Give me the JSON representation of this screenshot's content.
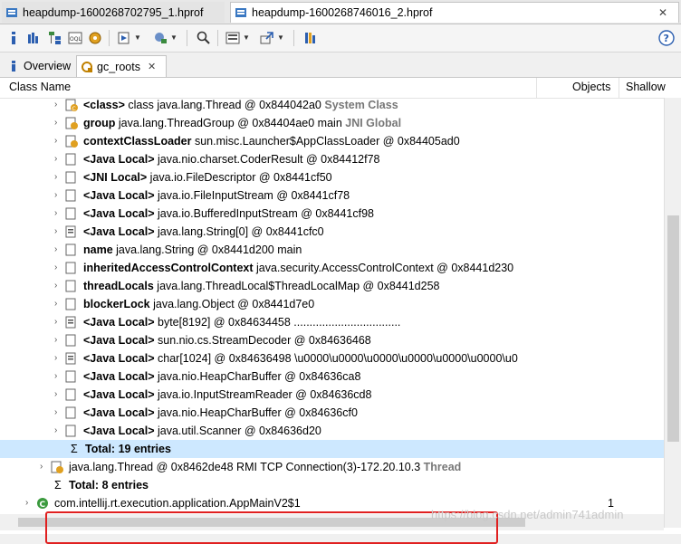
{
  "editor_tabs": [
    {
      "label": "heapdump-1600268702795_1.hprof"
    },
    {
      "label": "heapdump-1600268746016_2.hprof"
    }
  ],
  "view_tabs": [
    {
      "label": "Overview"
    },
    {
      "label": "gc_roots"
    }
  ],
  "columns": [
    "Class Name",
    "Objects",
    "Shallow"
  ],
  "rows": [
    {
      "bold": "<class>",
      "rest": " class java.lang.Thread @ 0x844042a0",
      "gray": " System Class"
    },
    {
      "bold": "group",
      "rest": " java.lang.ThreadGroup @ 0x84404ae0  main",
      "gray": " JNI Global"
    },
    {
      "bold": "contextClassLoader",
      "rest": " sun.misc.Launcher$AppClassLoader @ 0x84405ad0",
      "gray": ""
    },
    {
      "bold": "<Java Local>",
      "rest": " java.nio.charset.CoderResult @ 0x84412f78",
      "gray": ""
    },
    {
      "bold": "<JNI Local>",
      "rest": " java.io.FileDescriptor @ 0x8441cf50",
      "gray": ""
    },
    {
      "bold": "<Java Local>",
      "rest": " java.io.FileInputStream @ 0x8441cf78",
      "gray": ""
    },
    {
      "bold": "<Java Local>",
      "rest": " java.io.BufferedInputStream @ 0x8441cf98",
      "gray": ""
    },
    {
      "bold": "<Java Local>",
      "rest": " java.lang.String[0] @ 0x8441cfc0",
      "gray": ""
    },
    {
      "bold": "name",
      "rest": " java.lang.String @ 0x8441d200  main",
      "gray": ""
    },
    {
      "bold": "inheritedAccessControlContext",
      "rest": " java.security.AccessControlContext @ 0x8441d230",
      "gray": ""
    },
    {
      "bold": "threadLocals",
      "rest": " java.lang.ThreadLocal$ThreadLocalMap @ 0x8441d258",
      "gray": ""
    },
    {
      "bold": "blockerLock",
      "rest": " java.lang.Object @ 0x8441d7e0",
      "gray": ""
    },
    {
      "bold": "<Java Local>",
      "rest": " byte[8192] @ 0x84634458  ..................................",
      "gray": ""
    },
    {
      "bold": "<Java Local>",
      "rest": " sun.nio.cs.StreamDecoder @ 0x84636468",
      "gray": ""
    },
    {
      "bold": "<Java Local>",
      "rest": " char[1024] @ 0x84636498  \\u0000\\u0000\\u0000\\u0000\\u0000\\u0000\\u0",
      "gray": ""
    },
    {
      "bold": "<Java Local>",
      "rest": " java.nio.HeapCharBuffer @ 0x84636ca8",
      "gray": ""
    },
    {
      "bold": "<Java Local>",
      "rest": " java.io.InputStreamReader @ 0x84636cd8",
      "gray": ""
    },
    {
      "bold": "<Java Local>",
      "rest": " java.nio.HeapCharBuffer @ 0x84636cf0",
      "gray": ""
    },
    {
      "bold": "<Java Local>",
      "rest": " java.util.Scanner @ 0x84636d20",
      "gray": ""
    }
  ],
  "total_inner": "Total: 19 entries",
  "thread_row": {
    "rest": "java.lang.Thread @ 0x8462de48  RMI TCP Connection(3)-172.20.10.3",
    "gray": " Thread"
  },
  "total_outer": "Total: 8 entries",
  "app_row": {
    "text": "com.intellij.rt.execution.application.AppMainV2$1",
    "objects": "1"
  },
  "watermark": "https://blog.csdn.net/admin741admin"
}
